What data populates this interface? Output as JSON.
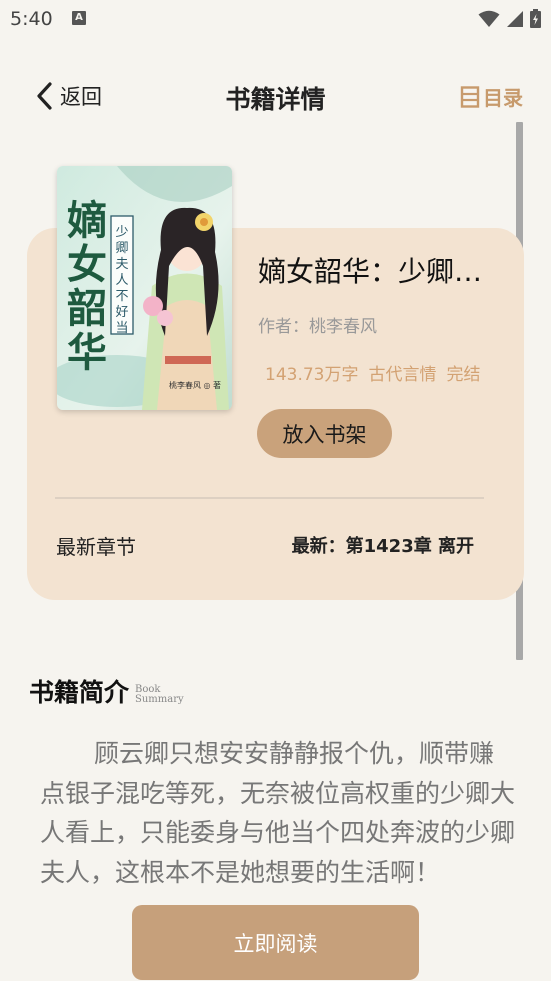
{
  "status_bar": {
    "time": "5:40",
    "notification_badge": "A",
    "icons": [
      "wifi-icon",
      "signal-icon",
      "battery-icon"
    ]
  },
  "header": {
    "back_label": "返回",
    "title": "书籍详情",
    "toc_label": "目录"
  },
  "book": {
    "title": "嫡女韶华：少卿夫人不好当",
    "author_line": "作者：桃李春风",
    "word_count": "143.73万字",
    "genre": "古代言情",
    "status": "完结",
    "shelf_button": "放入书架",
    "latest_label": "最新章节",
    "latest_chapter": "最新：第1423章 离开",
    "cover": {
      "title_chars": [
        "嫡",
        "女",
        "韶",
        "华"
      ],
      "subtitle": "少卿夫人不好当",
      "author_mark": "桃李春风 ◎ 著"
    }
  },
  "summary": {
    "title": "书籍简介",
    "sub_en_1": "Book",
    "sub_en_2": "Summary",
    "text": "顾云卿只想安安静静报个仇，顺带赚点银子混吃等死，无奈被位高权重的少卿大人看上，只能委身与他当个四处奔波的少卿夫人，这根本不是她想要的生活啊！"
  },
  "read_button": "立即阅读",
  "colors": {
    "background": "#f6f4ef",
    "card": "#f3e3d1",
    "accent": "#c9a27b",
    "meta": "#d3a273"
  }
}
